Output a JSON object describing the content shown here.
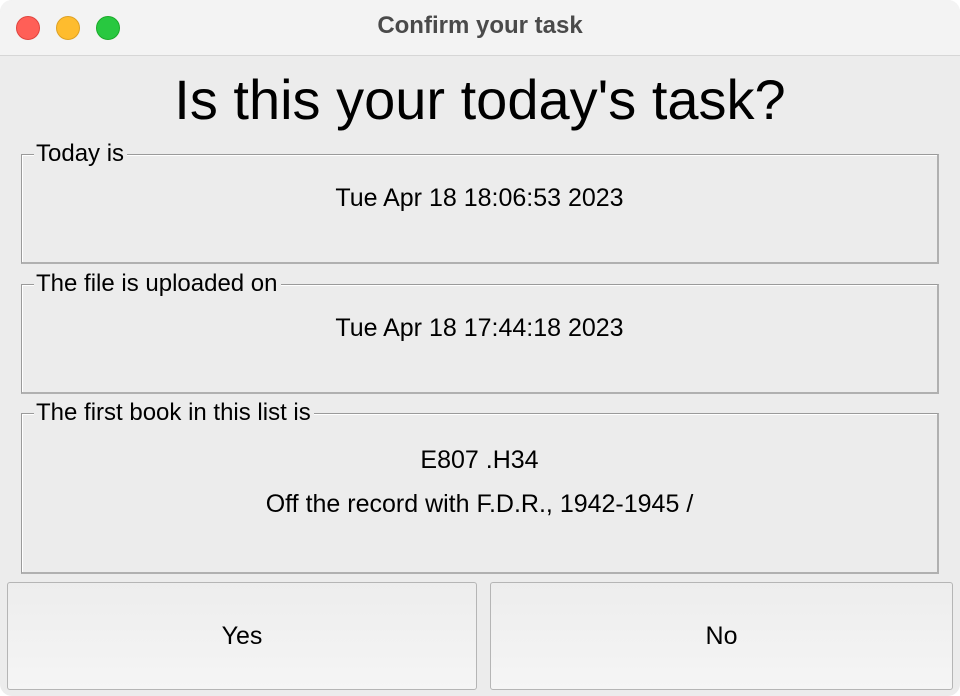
{
  "window": {
    "title": "Confirm your task"
  },
  "heading": "Is this your today's task?",
  "today": {
    "label": "Today is",
    "value": "Tue Apr 18 18:06:53 2023"
  },
  "uploaded": {
    "label": "The file is uploaded on",
    "value": "Tue Apr 18 17:44:18 2023"
  },
  "book": {
    "label": "The first book in this list is",
    "call_number": "E807 .H34",
    "title": "Off the record with F.D.R., 1942-1945 /"
  },
  "buttons": {
    "yes": "Yes",
    "no": "No"
  },
  "colors": {
    "close": "#ff5f57",
    "minimize": "#febc2e",
    "zoom": "#28c840"
  }
}
